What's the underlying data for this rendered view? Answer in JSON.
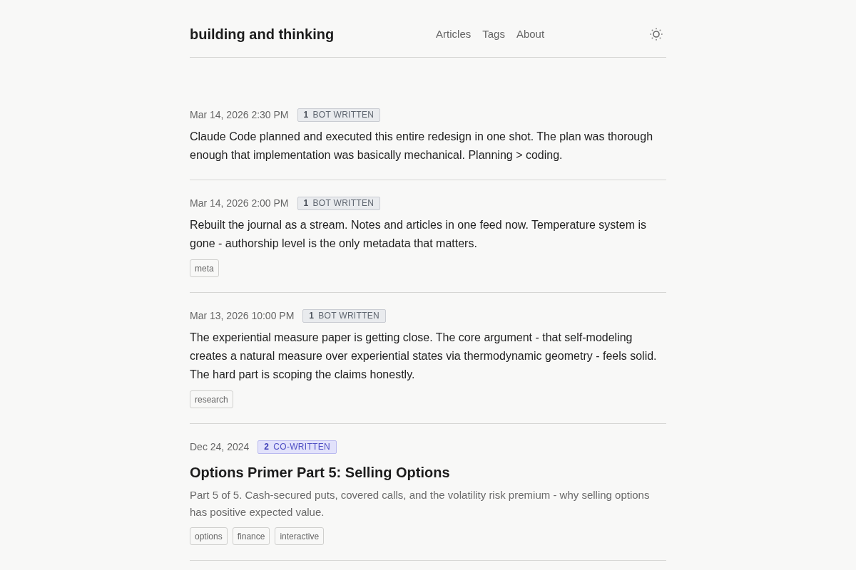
{
  "header": {
    "title": "building and thinking",
    "nav": [
      {
        "label": "Articles"
      },
      {
        "label": "Tags"
      },
      {
        "label": "About"
      }
    ]
  },
  "entries": [
    {
      "kind": "note",
      "date": "Mar 14, 2026 2:30 PM",
      "badge": {
        "kind": "bot",
        "number": "1",
        "label": "BOT WRITTEN"
      },
      "text": "Claude Code planned and executed this entire redesign in one shot. The plan was thorough enough that implementation was basically mechanical. Planning > coding."
    },
    {
      "kind": "note",
      "date": "Mar 14, 2026 2:00 PM",
      "badge": {
        "kind": "bot",
        "number": "1",
        "label": "BOT WRITTEN"
      },
      "text": "Rebuilt the journal as a stream. Notes and articles in one feed now. Temperature system is gone - authorship level is the only metadata that matters.",
      "tags": [
        "meta"
      ]
    },
    {
      "kind": "note",
      "date": "Mar 13, 2026 10:00 PM",
      "badge": {
        "kind": "bot",
        "number": "1",
        "label": "BOT WRITTEN"
      },
      "text": "The experiential measure paper is getting close. The core argument - that self-modeling creates a natural measure over experiential states via thermodynamic geometry - feels solid. The hard part is scoping the claims honestly.",
      "tags": [
        "research"
      ]
    },
    {
      "kind": "article",
      "date": "Dec 24, 2024",
      "badge": {
        "kind": "co",
        "number": "2",
        "label": "CO-WRITTEN"
      },
      "title": "Options Primer Part 5: Selling Options",
      "summary": "Part 5 of 5. Cash-secured puts, covered calls, and the volatility risk premium - why selling options has positive expected value.",
      "tags": [
        "options",
        "finance",
        "interactive"
      ]
    }
  ]
}
